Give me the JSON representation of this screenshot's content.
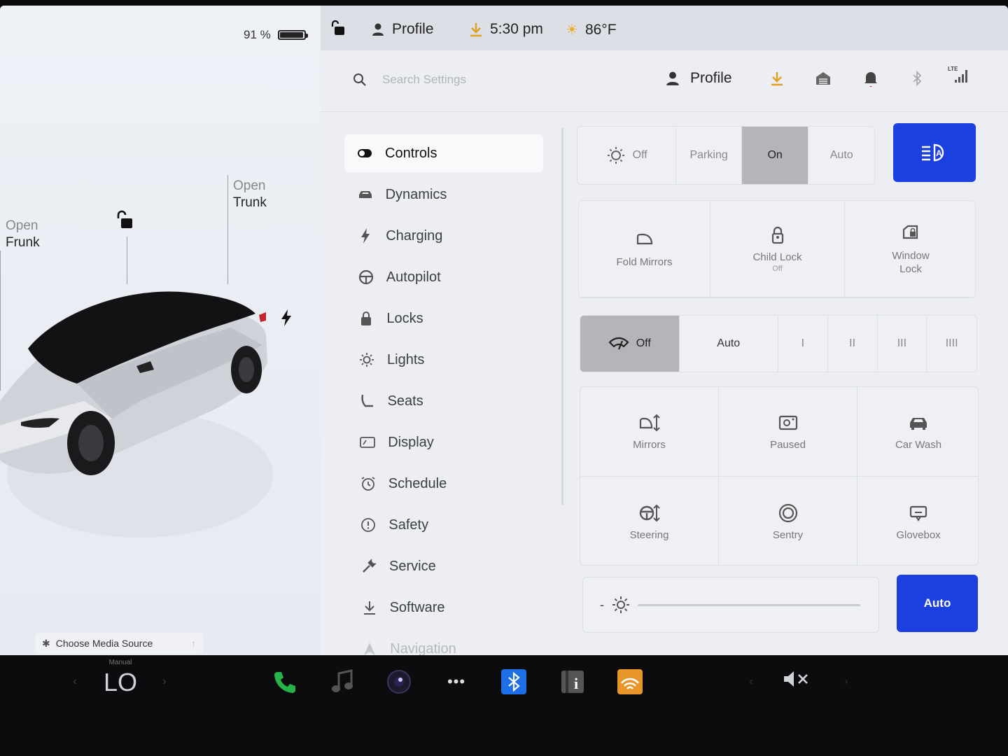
{
  "car": {
    "battery_percent": "91 %",
    "battery_level": 0.91,
    "frunk_open": "Open",
    "frunk_name": "Frunk",
    "trunk_open": "Open",
    "trunk_name": "Trunk",
    "media_source": "Choose Media Source"
  },
  "status_bar": {
    "profile": "Profile",
    "time": "5:30 pm",
    "temperature": "86°F"
  },
  "header": {
    "search_placeholder": "Search Settings",
    "profile": "Profile",
    "signal": "LTE"
  },
  "nav": {
    "items": [
      {
        "label": "Controls",
        "icon": "toggle-icon"
      },
      {
        "label": "Dynamics",
        "icon": "car-icon"
      },
      {
        "label": "Charging",
        "icon": "bolt-icon"
      },
      {
        "label": "Autopilot",
        "icon": "steering-wheel-icon"
      },
      {
        "label": "Locks",
        "icon": "lock-icon"
      },
      {
        "label": "Lights",
        "icon": "sun-icon"
      },
      {
        "label": "Seats",
        "icon": "seat-icon"
      },
      {
        "label": "Display",
        "icon": "display-icon"
      },
      {
        "label": "Schedule",
        "icon": "alarm-clock-icon"
      },
      {
        "label": "Safety",
        "icon": "alert-circle-icon"
      },
      {
        "label": "Service",
        "icon": "wrench-icon"
      },
      {
        "label": "Software",
        "icon": "download-icon"
      },
      {
        "label": "Navigation",
        "icon": "navigation-icon"
      }
    ]
  },
  "controls": {
    "headlights": {
      "options": [
        "Off",
        "Parking",
        "On",
        "Auto"
      ],
      "selected": "On"
    },
    "mirror_tiles": {
      "fold_mirrors": "Fold Mirrors",
      "child_lock": "Child Lock",
      "child_lock_state": "Off",
      "window_lock": "Window Lock"
    },
    "wipers": {
      "options": [
        "Off",
        "Auto",
        "I",
        "II",
        "III",
        "IIII"
      ],
      "selected": "Off"
    },
    "grid_tiles": {
      "mirrors": "Mirrors",
      "steering": "Steering",
      "paused": "Paused",
      "sentry": "Sentry",
      "car_wash": "Car Wash",
      "glovebox": "Glovebox"
    },
    "brightness_minus": "-",
    "brightness_auto": "Auto"
  },
  "taskbar": {
    "climate_mode": "Manual",
    "temperature": "LO"
  },
  "colors": {
    "accent_blue": "#1c3fe0",
    "download_orange": "#e0a020",
    "phone_green": "#27b34a",
    "bluetooth_blue": "#1e6fe6",
    "audible_orange": "#e8962a"
  }
}
